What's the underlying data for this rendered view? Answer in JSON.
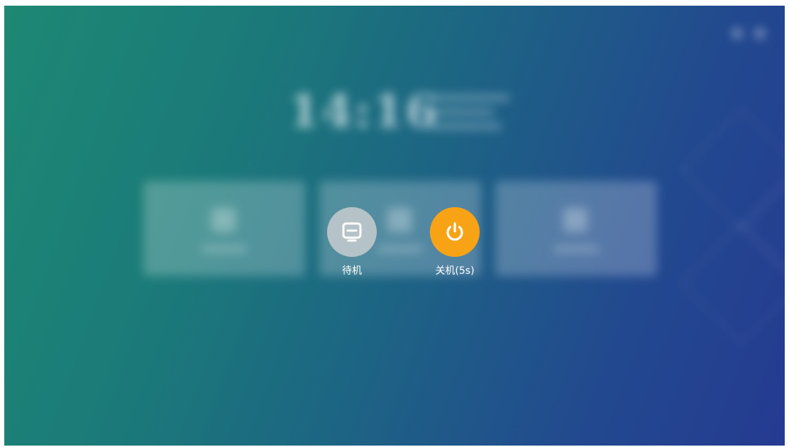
{
  "background": {
    "clock": "14:16"
  },
  "power_dialog": {
    "standby": {
      "label": "待机",
      "icon": "monitor-icon",
      "color": "#b5c3c9"
    },
    "shutdown": {
      "label": "关机(5s)",
      "icon": "power-icon",
      "color": "#f8a316"
    }
  }
}
